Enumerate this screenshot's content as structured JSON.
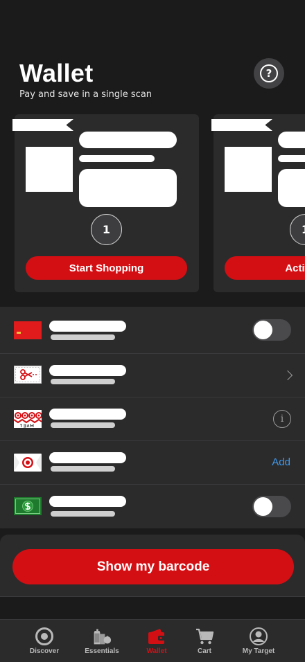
{
  "header": {
    "title": "Wallet",
    "subtitle": "Pay and save in a single scan",
    "help_glyph": "?",
    "help_icon": "question-circle-icon"
  },
  "offers": [
    {
      "count": "1",
      "button_label": "Start Shopping"
    },
    {
      "count": "1",
      "button_label": "Activate"
    }
  ],
  "wallet_items": [
    {
      "icon": "red-card-icon",
      "control": "toggle",
      "toggle_on": false
    },
    {
      "icon": "scissors-coupon-icon",
      "control": "chevron"
    },
    {
      "icon": "team-target-icon",
      "control": "info",
      "info_glyph": "i"
    },
    {
      "icon": "target-card-icon",
      "control": "link",
      "link_label": "Add"
    },
    {
      "icon": "dollar-bill-icon",
      "control": "toggle",
      "toggle_on": false
    }
  ],
  "barcode": {
    "button_label": "Show my barcode"
  },
  "tabbar": {
    "tabs": [
      {
        "label": "Discover",
        "icon": "bullseye-icon",
        "active": false
      },
      {
        "label": "Essentials",
        "icon": "grocery-icon",
        "active": false
      },
      {
        "label": "Wallet",
        "icon": "wallet-icon",
        "active": true
      },
      {
        "label": "Cart",
        "icon": "cart-icon",
        "active": false
      },
      {
        "label": "My Target",
        "icon": "profile-icon",
        "active": false
      }
    ]
  },
  "colors": {
    "background": "#1b1b1c",
    "surface": "#2b2b2c",
    "accent": "#d40f14",
    "link": "#3f9bef"
  }
}
